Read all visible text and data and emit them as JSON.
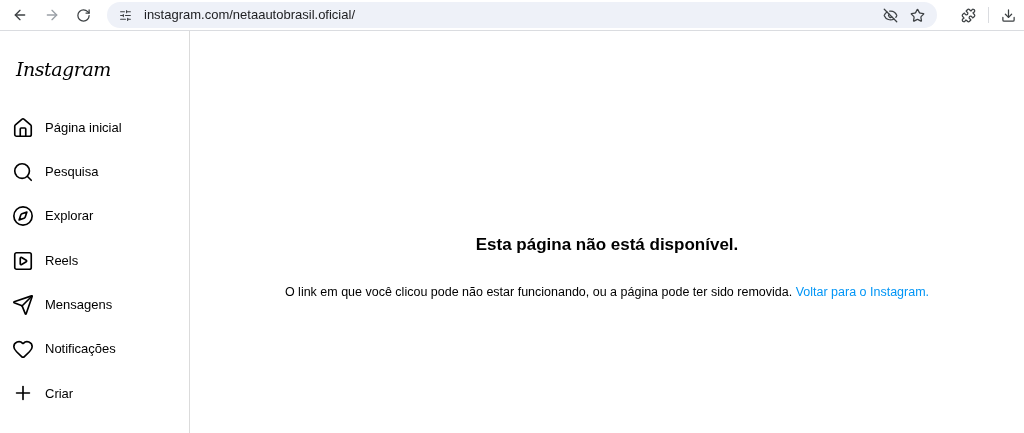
{
  "browser": {
    "url": "instagram.com/netaautobrasil.oficial/"
  },
  "sidebar": {
    "logo": "Instagram",
    "items": [
      {
        "kind": "home",
        "label": "Página inicial"
      },
      {
        "kind": "search",
        "label": "Pesquisa"
      },
      {
        "kind": "explore",
        "label": "Explorar"
      },
      {
        "kind": "reels",
        "label": "Reels"
      },
      {
        "kind": "messages",
        "label": "Mensagens"
      },
      {
        "kind": "notifications",
        "label": "Notificações"
      },
      {
        "kind": "create",
        "label": "Criar"
      }
    ]
  },
  "error": {
    "title": "Esta página não está disponível.",
    "message": "O link em que você clicou pode não estar funcionando, ou a página pode ter sido removida.",
    "link": "Voltar para o Instagram."
  }
}
